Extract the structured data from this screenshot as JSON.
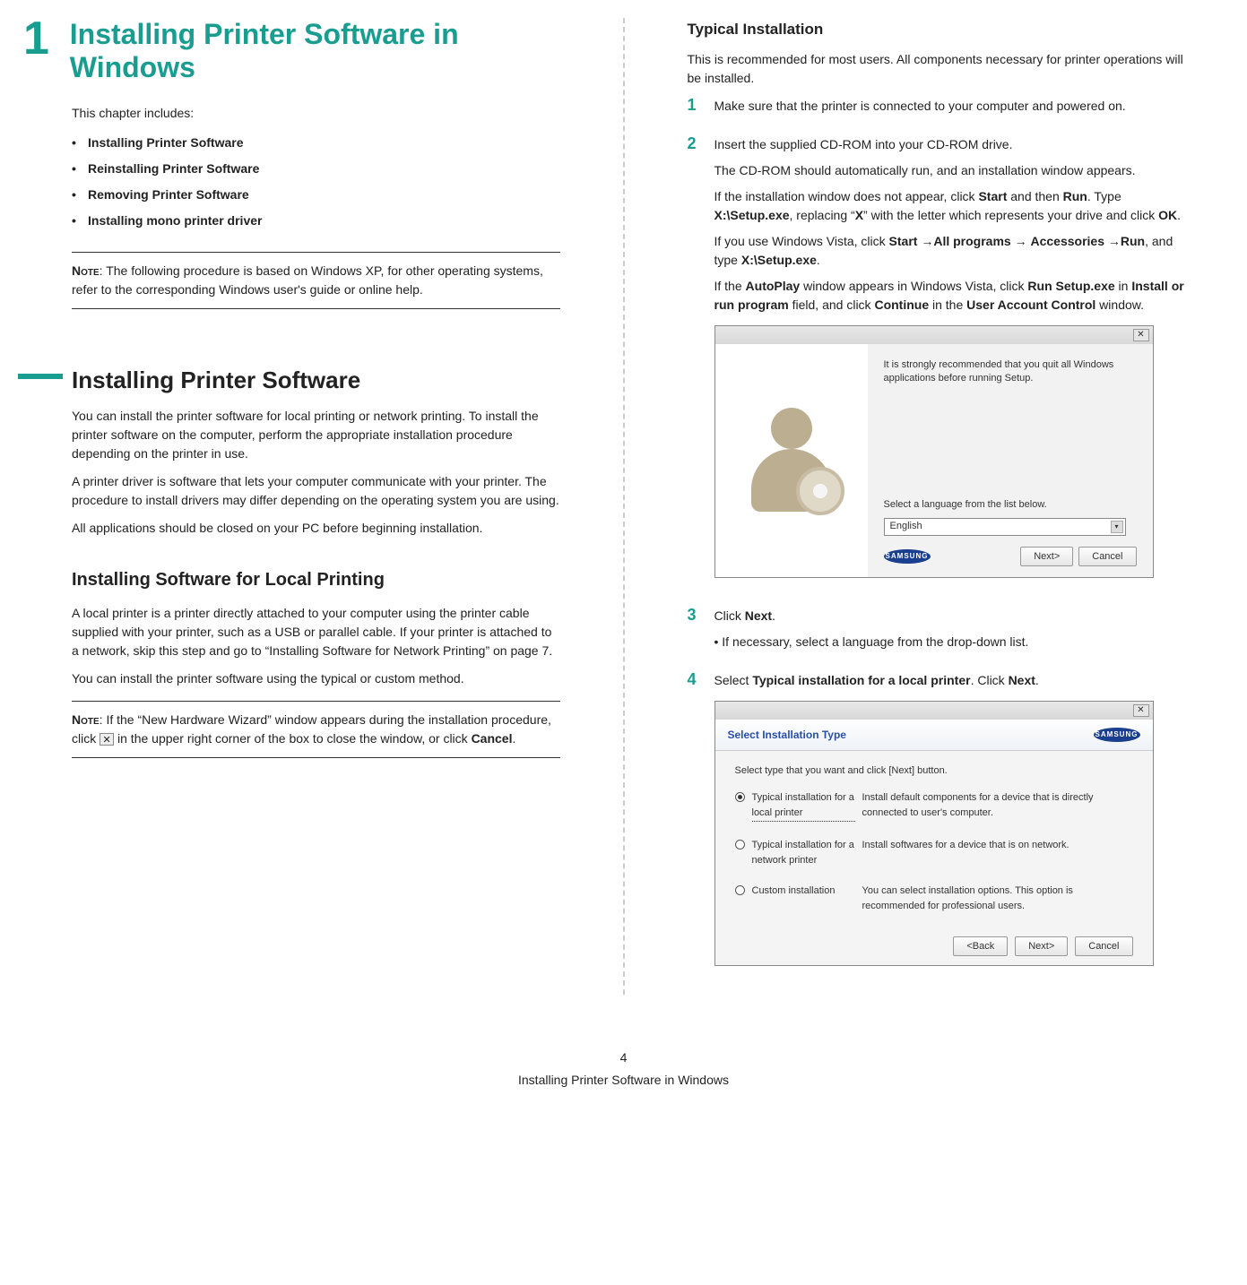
{
  "chapter": {
    "number": "1",
    "title": "Installing Printer Software in Windows",
    "intro": "This chapter includes:",
    "toc": [
      "Installing Printer Software",
      "Reinstalling Printer Software",
      "Removing Printer Software",
      "Installing mono printer driver"
    ],
    "note_label": "Note",
    "note_text": ": The following procedure is based on Windows XP, for other operating systems, refer to the corresponding Windows user's guide or online help."
  },
  "section1": {
    "title": "Installing Printer Software",
    "p1": "You can install the printer software for local printing or network printing. To install the printer software on the computer, perform the appropriate installation procedure depending on the printer in use.",
    "p2": "A printer driver is software that lets your computer communicate with your printer. The procedure to install drivers may differ depending on the operating system you are using.",
    "p3": "All applications should be closed on your PC before beginning installation."
  },
  "section2": {
    "title": "Installing Software for Local Printing",
    "p1": "A local printer is a printer directly attached to your computer using the printer cable supplied with your printer, such as a USB or parallel cable. If your printer is attached to a network, skip this step and go to “Installing Software for Network Printing” on page 7.",
    "p2": "You can install the printer software using the typical or custom method.",
    "note_label": "Note",
    "note_before": ": If the “New Hardware Wizard” window appears during the installation procedure, click ",
    "note_after": " in the upper right corner of the box to close the window, or click ",
    "note_cancel": "Cancel",
    "note_end": "."
  },
  "col2": {
    "typical_title": "Typical Installation",
    "typical_intro": "This is recommended for most users. All components necessary for printer operations will be installed.",
    "step1": "Make sure that the printer is connected to your computer and powered on.",
    "step2_a": "Insert the supplied CD-ROM into your CD-ROM drive.",
    "step2_b": "The CD-ROM should automatically run, and an installation window appears.",
    "step2_c_pre": "If the installation window does not appear, click ",
    "step2_c_start": "Start",
    "step2_c_and": " and then ",
    "step2_c_run": "Run",
    "step2_c_type": ". Type ",
    "step2_c_setup": "X:\\Setup.exe",
    "step2_c_repl": ", replacing “",
    "step2_c_x": "X",
    "step2_c_with": "” with the letter which represents your drive and click ",
    "step2_c_ok": "OK",
    "step2_c_dot": ".",
    "step2_d_pre": "If you use Windows Vista, click ",
    "step2_d_start": "Start",
    "step2_d_arrow1": " →",
    "step2_d_allprog": "All programs",
    "step2_d_arrow2": " → ",
    "step2_d_acc": "Accessories",
    "step2_d_arrow3": " →",
    "step2_d_run": "Run",
    "step2_d_and": ", and type ",
    "step2_d_setup": "X:\\Setup.exe",
    "step2_d_dot": ".",
    "step2_e_pre": "If the ",
    "step2_e_auto": "AutoPlay",
    "step2_e_mid1": " window appears in Windows Vista, click ",
    "step2_e_runsetup": "Run Setup.exe",
    "step2_e_in1": " in ",
    "step2_e_install": "Install or run program",
    "step2_e_mid2": " field, and click ",
    "step2_e_cont": "Continue",
    "step2_e_in2": " in the ",
    "step2_e_uac": "User Account Control",
    "step2_e_end": " window.",
    "step3_click": "Click ",
    "step3_next": "Next",
    "step3_dot": ".",
    "step3_bullet": "• If necessary, select a language from the drop-down list.",
    "step4_select": "Select ",
    "step4_typical": "Typical installation for a local printer",
    "step4_click": ". Click ",
    "step4_next": "Next",
    "step4_dot": "."
  },
  "mock1": {
    "msg": "It is strongly recommended that you quit all Windows applications before running Setup.",
    "lang_label": "Select a language from the list below.",
    "lang_value": "English",
    "btn_next": "Next>",
    "btn_cancel": "Cancel",
    "logo": "SAMSUNG"
  },
  "mock2": {
    "title": "Select Installation Type",
    "sub": "Select type that you want and click [Next] button.",
    "opt1_label": "Typical installation for a local printer",
    "opt1_desc": "Install default components for a device that is directly connected to user's computer.",
    "opt2_label": "Typical installation for a network printer",
    "opt2_desc": "Install softwares for a device that is on network.",
    "opt3_label": "Custom installation",
    "opt3_desc": "You can select installation options. This option is recommended for professional users.",
    "btn_back": "<Back",
    "btn_next": "Next>",
    "btn_cancel": "Cancel",
    "logo": "SAMSUNG"
  },
  "footer": {
    "page": "4",
    "running": "Installing Printer Software in Windows"
  }
}
